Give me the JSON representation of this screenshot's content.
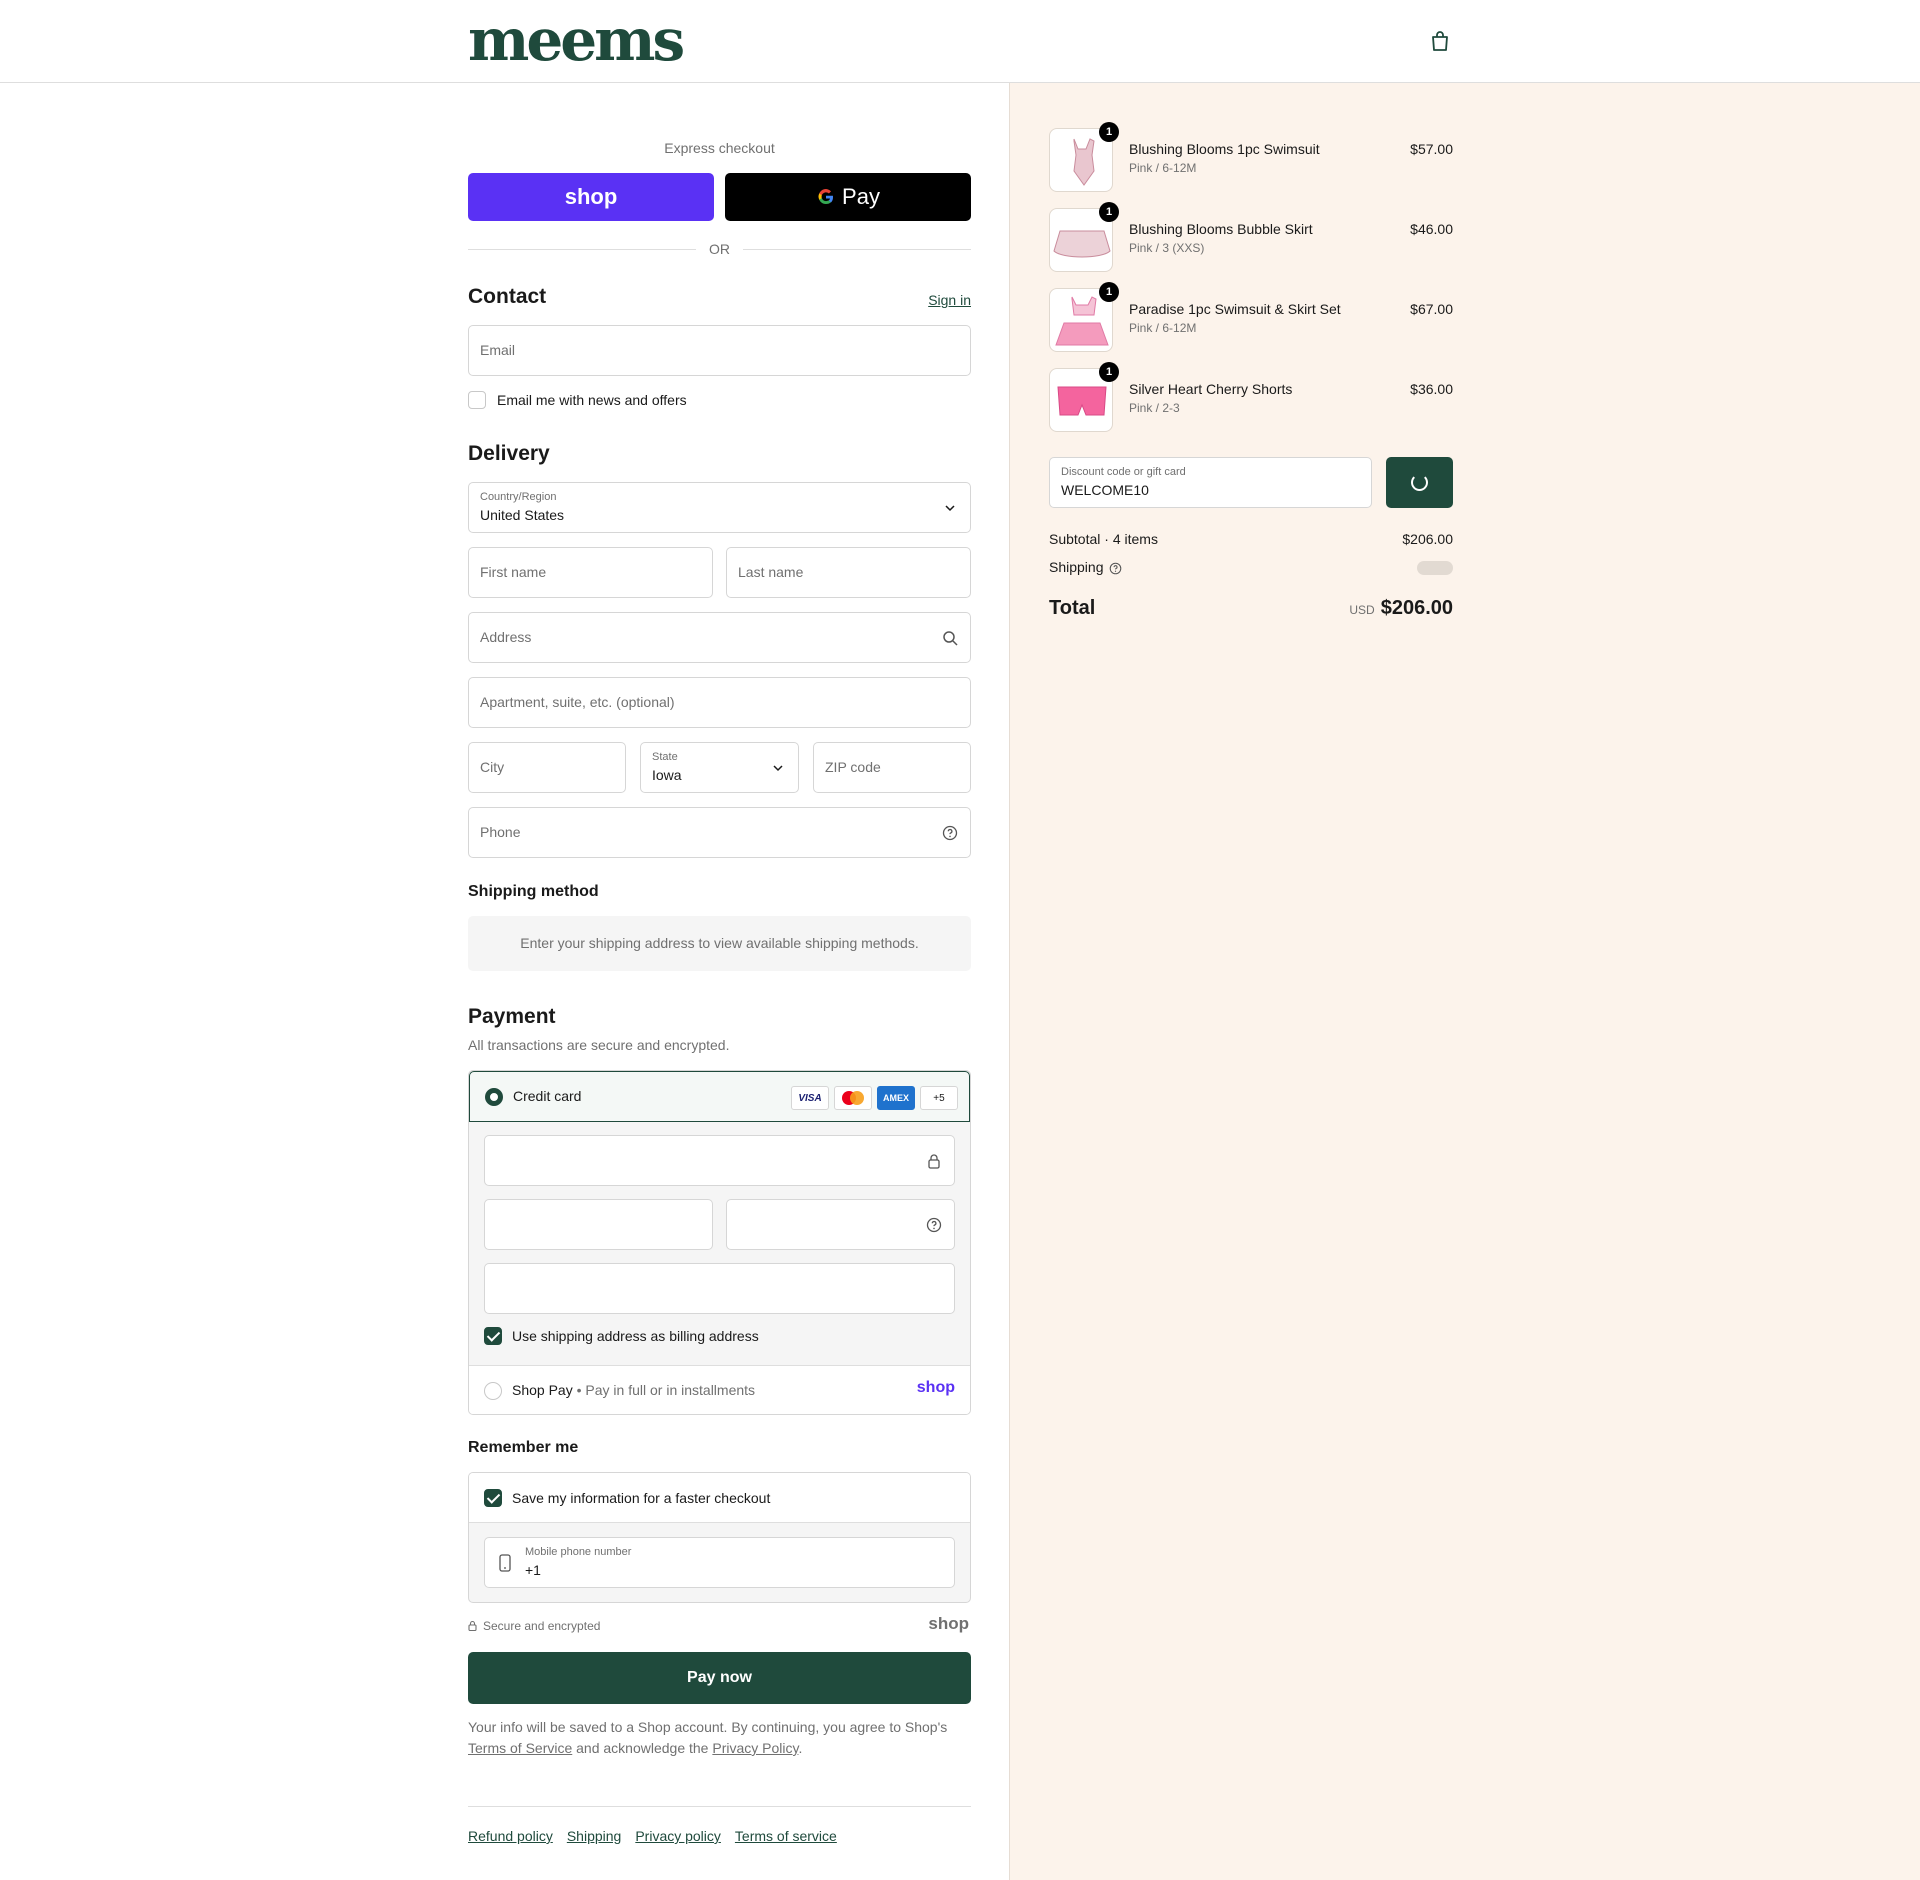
{
  "brand": {
    "logo": "meems",
    "accent": "#1f4a3c",
    "shop_color": "#5a31f4"
  },
  "express": {
    "label": "Express checkout",
    "shop_label": "shop",
    "gpay_label": "Pay",
    "or_label": "OR"
  },
  "contact": {
    "title": "Contact",
    "sign_in": "Sign in",
    "email_placeholder": "Email",
    "newsletter_label": "Email me with news and offers"
  },
  "delivery": {
    "title": "Delivery",
    "country_label": "Country/Region",
    "country_value": "United States",
    "first_name": "First name",
    "last_name": "Last name",
    "address": "Address",
    "apartment": "Apartment, suite, etc. (optional)",
    "city": "City",
    "state_label": "State",
    "state_value": "Iowa",
    "zip": "ZIP code",
    "phone": "Phone"
  },
  "shipping_method": {
    "title": "Shipping method",
    "message": "Enter your shipping address to view available shipping methods."
  },
  "payment": {
    "title": "Payment",
    "subtitle": "All transactions are secure and encrypted.",
    "credit_card_label": "Credit card",
    "cards": [
      "VISA",
      "MC",
      "AMEX",
      "+5"
    ],
    "billing_label": "Use shipping address as billing address",
    "shop_pay_label": "Shop Pay",
    "shop_pay_sub": "Pay in full or in installments",
    "shop_pay_logo": "shop"
  },
  "remember": {
    "title": "Remember me",
    "save_label": "Save my information for a faster checkout",
    "phone_label": "Mobile phone number",
    "phone_value": "+1",
    "secure_label": "Secure and encrypted",
    "shop_logo": "shop"
  },
  "pay_now": "Pay now",
  "legal": {
    "text1": "Your info will be saved to a Shop account. By continuing, you agree to Shop's",
    "tos": "Terms of Service",
    "text2": "and acknowledge the",
    "privacy": "Privacy Policy",
    "end": "."
  },
  "footer": [
    "Refund policy",
    "Shipping",
    "Privacy policy",
    "Terms of service"
  ],
  "cart": {
    "items": [
      {
        "name": "Blushing Blooms 1pc Swimsuit",
        "variant": "Pink / 6-12M",
        "price": "$57.00",
        "qty": "1"
      },
      {
        "name": "Blushing Blooms Bubble Skirt",
        "variant": "Pink / 3 (XXS)",
        "price": "$46.00",
        "qty": "1"
      },
      {
        "name": "Paradise 1pc Swimsuit & Skirt Set",
        "variant": "Pink / 6-12M",
        "price": "$67.00",
        "qty": "1"
      },
      {
        "name": "Silver Heart Cherry Shorts",
        "variant": "Pink / 2-3",
        "price": "$36.00",
        "qty": "1"
      }
    ],
    "discount_label": "Discount code or gift card",
    "discount_value": "WELCOME10",
    "subtotal_label": "Subtotal · 4 items",
    "subtotal_value": "$206.00",
    "shipping_label": "Shipping",
    "total_label": "Total",
    "currency": "USD",
    "total_value": "$206.00"
  }
}
